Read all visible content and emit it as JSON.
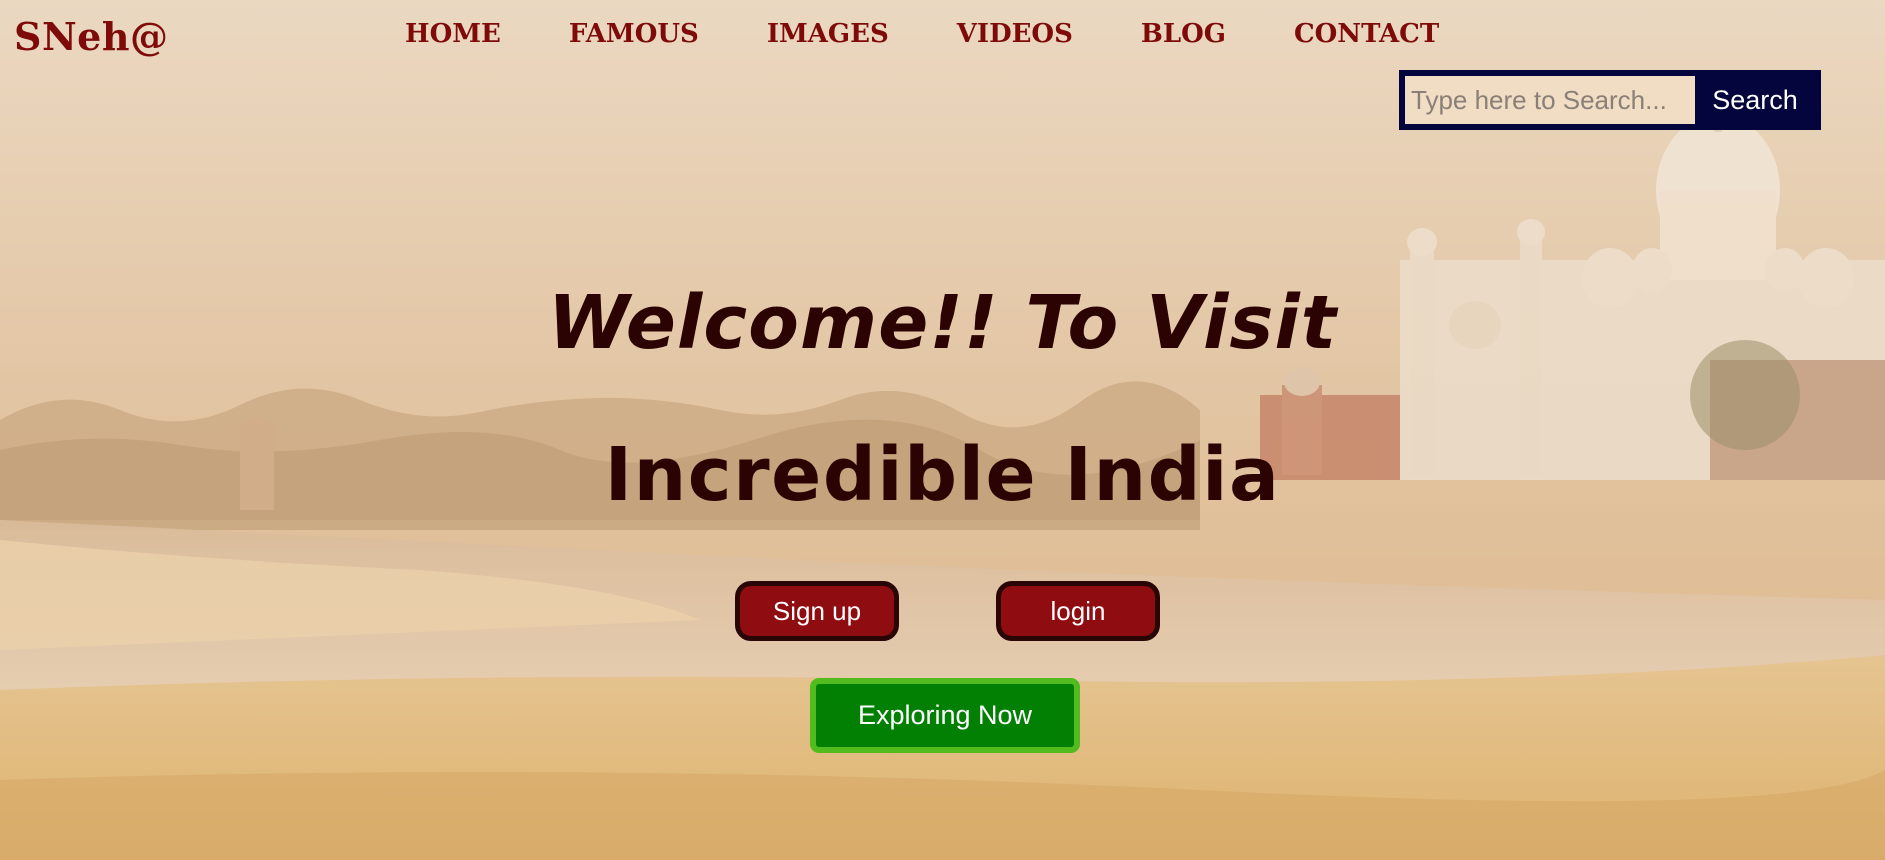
{
  "brand": {
    "logo": "SNeh@"
  },
  "nav": {
    "items": [
      {
        "label": "HOME"
      },
      {
        "label": "FAMOUS"
      },
      {
        "label": "IMAGES"
      },
      {
        "label": "VIDEOS"
      },
      {
        "label": "BLOG"
      },
      {
        "label": "CONTACT"
      }
    ]
  },
  "search": {
    "placeholder": "Type here to Search...",
    "value": "",
    "button_label": "Search"
  },
  "hero": {
    "line1": "Welcome!! To Visit",
    "line2": "Incredible India"
  },
  "actions": {
    "signup_label": "Sign up",
    "login_label": "login",
    "explore_label": "Exploring Now"
  },
  "colors": {
    "brand_maroon": "#7e0a0a",
    "headline": "#2c0303",
    "search_navy": "#05053d",
    "button_red": "#8f0c10",
    "explore_green": "#028004"
  },
  "background": {
    "scene": "taj-mahal-river-landscape"
  }
}
